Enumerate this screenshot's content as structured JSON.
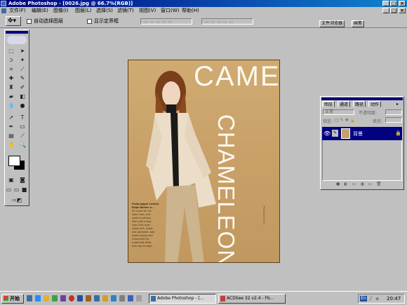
{
  "window": {
    "title": "Adobe Photoshop - [0026.jpg @ 66.7%(RGB)]",
    "controls": [
      "_",
      "□",
      "×"
    ]
  },
  "menubar": {
    "items": [
      "文件(F)",
      "编辑(E)",
      "图像(I)",
      "图层(L)",
      "选择(S)",
      "滤镜(T)",
      "视图(V)",
      "窗口(W)",
      "帮助(H)"
    ],
    "doc_controls": [
      "_",
      "□",
      "×"
    ]
  },
  "options_bar": {
    "auto_select_layer": "自动选择图层",
    "show_bounding_box": "显示定界框",
    "palette_tabs": [
      "文件浏览器",
      "画笔"
    ]
  },
  "document": {
    "headline_1": "CAMEL",
    "headline_2": "CHAMELEON",
    "caption_lines": [
      "Paula Jagger Lachica",
      "Ralph Bohlen n...",
      "It's camel for fall",
      "sleek, lean, and",
      "ready to seduce.",
      "Start with a long",
      "coat, then layer",
      "cream knit, suede",
      "and cashmere. Add",
      "sheer hosiery and",
      "a fluid skirt for",
      "a look that shifts",
      "from day to night."
    ],
    "sidebar_credit": "Photographed by ..."
  },
  "layers_panel": {
    "tabs": [
      "图层",
      "通道",
      "路径",
      "动作"
    ],
    "blend_mode": "正常",
    "opacity_label": "不透明度:",
    "lock_label": "锁定:",
    "fill_label": "填充:",
    "layer_name": "背景"
  },
  "taskbar": {
    "start": "开始",
    "tasks": [
      "Adobe Photoshop - [...",
      "ACDSee 32 v2.4 - Fb..."
    ],
    "tray_lang": "En",
    "clock": "20:47"
  }
}
